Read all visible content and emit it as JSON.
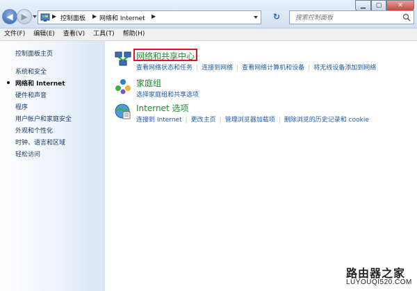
{
  "address": {
    "crumbs": [
      "控制面板",
      "网络和 Internet"
    ],
    "search_placeholder": "搜索控制面板"
  },
  "menubar": [
    "文件(F)",
    "编辑(E)",
    "查看(V)",
    "工具(T)",
    "帮助(H)"
  ],
  "sidebar": {
    "home": "控制面板主页",
    "items": [
      "系统和安全",
      "网络和 Internet",
      "硬件和声音",
      "程序",
      "用户帐户和家庭安全",
      "外观和个性化",
      "时钟、语言和区域",
      "轻松访问"
    ],
    "current_index": 1
  },
  "categories": [
    {
      "title": "网络和共享中心",
      "icon": "network-sharing-icon",
      "links": [
        "查看网络状态和任务",
        "连接到网络",
        "查看网络计算机和设备",
        "将无线设备添加到网络"
      ]
    },
    {
      "title": "家庭组",
      "icon": "homegroup-icon",
      "links": [
        "选择家庭组和共享选项"
      ]
    },
    {
      "title": "Internet 选项",
      "icon": "internet-options-icon",
      "links": [
        "连接到 Internet",
        "更改主页",
        "管理浏览器加载项",
        "删除浏览的历史记录和 cookie"
      ]
    }
  ],
  "watermark": {
    "title": "路由器之家",
    "url": "LUYOUQI520.COM"
  },
  "colors": {
    "category_title": "#1e8b2e",
    "link": "#1e5aa8",
    "highlight": "#d9161b"
  }
}
